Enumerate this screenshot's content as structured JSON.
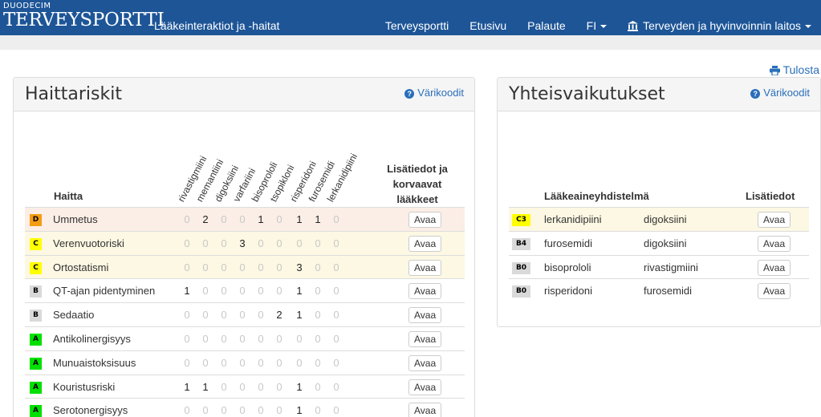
{
  "brand": {
    "small": "DUODECIM",
    "big": "TERVEYSPORTTI"
  },
  "app_title": "Lääkeinteraktiot ja -haitat",
  "nav": [
    {
      "label": "Terveysportti",
      "dropdown": false
    },
    {
      "label": "Etusivu",
      "dropdown": false
    },
    {
      "label": "Palaute",
      "dropdown": false
    },
    {
      "label": "FI",
      "dropdown": true
    },
    {
      "label": "Terveyden ja hyvinvoinnin laitos",
      "dropdown": true,
      "icon": "bank-icon"
    }
  ],
  "print_label": "Tulosta",
  "colors": {
    "navbar": "#1d5597",
    "link": "#2a6eba",
    "D": "#f39c12",
    "C": "#ffff00",
    "B": "#d9d9d9",
    "A": "#00e000"
  },
  "left_panel": {
    "title": "Haittariskit",
    "colorcodes": "Värikoodit",
    "col_haitta": "Haitta",
    "col_lisatiedot": "Lisätiedot ja korvaavat lääkkeet",
    "drugs": [
      "rivastigmiini",
      "memantiini",
      "digoksiini",
      "varfariini",
      "bisoprololi",
      "tsopikloni",
      "risperidoni",
      "furosemidi",
      "lerkanidipiini"
    ],
    "rows": [
      {
        "class": "D",
        "name": "Ummetus",
        "values": [
          0,
          2,
          0,
          0,
          1,
          0,
          1,
          1,
          0
        ],
        "button": "Avaa"
      },
      {
        "class": "C",
        "name": "Verenvuotoriski",
        "values": [
          0,
          0,
          0,
          3,
          0,
          0,
          0,
          0,
          0
        ],
        "button": "Avaa"
      },
      {
        "class": "C",
        "name": "Ortostatismi",
        "values": [
          0,
          0,
          0,
          0,
          0,
          0,
          3,
          0,
          0
        ],
        "button": "Avaa"
      },
      {
        "class": "B",
        "name": "QT-ajan pidentyminen",
        "values": [
          1,
          0,
          0,
          0,
          0,
          0,
          1,
          0,
          0
        ],
        "button": "Avaa"
      },
      {
        "class": "B",
        "name": "Sedaatio",
        "values": [
          0,
          0,
          0,
          0,
          0,
          2,
          1,
          0,
          0
        ],
        "button": "Avaa"
      },
      {
        "class": "A",
        "name": "Antikolinergisyys",
        "values": [
          0,
          0,
          0,
          0,
          0,
          0,
          0,
          0,
          0
        ],
        "button": "Avaa"
      },
      {
        "class": "A",
        "name": "Munuaistoksisuus",
        "values": [
          0,
          0,
          0,
          0,
          0,
          0,
          0,
          0,
          0
        ],
        "button": "Avaa"
      },
      {
        "class": "A",
        "name": "Kouristusriski",
        "values": [
          1,
          1,
          0,
          0,
          0,
          0,
          1,
          0,
          0
        ],
        "button": "Avaa"
      },
      {
        "class": "A",
        "name": "Serotonergisyys",
        "values": [
          0,
          0,
          0,
          0,
          0,
          0,
          1,
          0,
          0
        ],
        "button": "Avaa"
      }
    ]
  },
  "right_panel": {
    "title": "Yhteisvaikutukset",
    "colorcodes": "Värikoodit",
    "col_combination": "Lääkeaineyhdistelmä",
    "col_lisatiedot": "Lisätiedot",
    "rows": [
      {
        "code": "C3",
        "drug1": "lerkanidipiini",
        "drug2": "digoksiini",
        "button": "Avaa"
      },
      {
        "code": "B4",
        "drug1": "furosemidi",
        "drug2": "digoksiini",
        "button": "Avaa"
      },
      {
        "code": "B0",
        "drug1": "bisoprololi",
        "drug2": "rivastigmiini",
        "button": "Avaa"
      },
      {
        "code": "B0",
        "drug1": "risperidoni",
        "drug2": "furosemidi",
        "button": "Avaa"
      }
    ]
  }
}
